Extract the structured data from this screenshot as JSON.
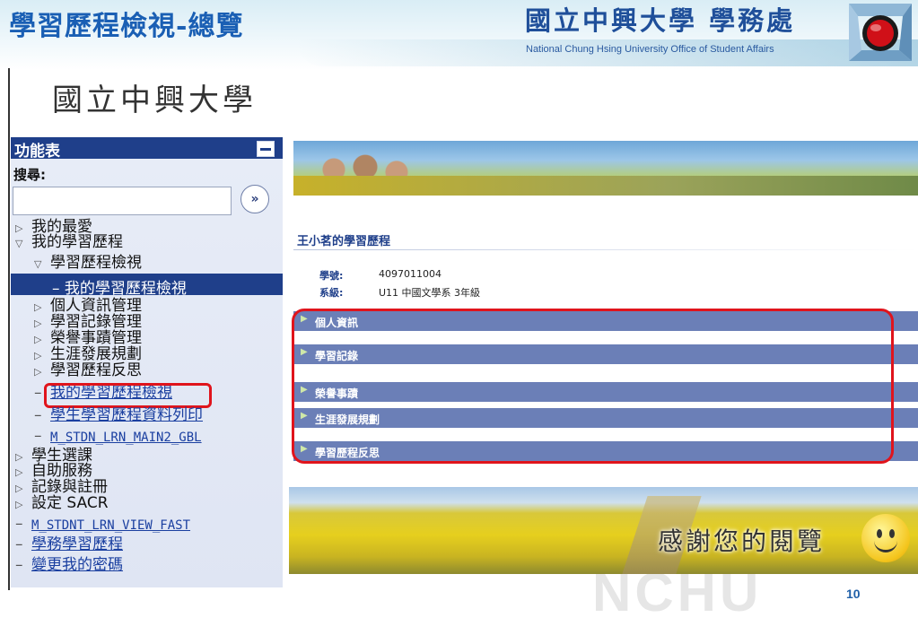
{
  "slide": {
    "title": "學習歷程檢視-總覽",
    "office_name_zh": "國立中興大學 學務處",
    "office_name_en": "National Chung Hsing University Office of Student Affairs",
    "page_number": "10",
    "watermark": "NCHU",
    "thanks_text": "感謝您的閱覽"
  },
  "university_name": "國立中興大學",
  "menu": {
    "header": "功能表",
    "search_label": "搜尋:",
    "search_value": "",
    "go_symbol": "»",
    "items": [
      {
        "label": "我的最愛",
        "type": "collapsed"
      },
      {
        "label": "我的學習歷程",
        "type": "expanded"
      },
      {
        "label": "學習歷程檢視",
        "type": "expanded"
      },
      {
        "label": "– 我的學習歷程檢視",
        "type": "selected"
      },
      {
        "label": "個人資訊管理",
        "type": "collapsed"
      },
      {
        "label": "學習記錄管理",
        "type": "collapsed"
      },
      {
        "label": "榮譽事蹟管理",
        "type": "collapsed"
      },
      {
        "label": "生涯發展規劃",
        "type": "collapsed"
      },
      {
        "label": "學習歷程反思",
        "type": "collapsed"
      },
      {
        "label": "我的學習歷程檢視",
        "type": "link"
      },
      {
        "label": "學生學習歷程資料列印",
        "type": "link"
      },
      {
        "label": "M_STDN_LRN_MAIN2_GBL",
        "type": "link"
      },
      {
        "label": "學生選課",
        "type": "collapsed"
      },
      {
        "label": "自助服務",
        "type": "collapsed"
      },
      {
        "label": "記錄與註冊",
        "type": "collapsed"
      },
      {
        "label": "設定 SACR",
        "type": "collapsed"
      },
      {
        "label": "M_STDNT_LRN_VIEW_FAST",
        "type": "link"
      },
      {
        "label": "學務學習歷程",
        "type": "link"
      },
      {
        "label": "變更我的密碼",
        "type": "link"
      }
    ]
  },
  "main": {
    "student_title": "王小茗的學習歷程",
    "student_id_label": "學號:",
    "student_id": "4097011004",
    "dept_label": "系級:",
    "dept": "U11 中國文學系 3年級",
    "sections": [
      "個人資訊",
      "學習記錄",
      "榮譽事蹟",
      "生涯發展規劃",
      "學習歷程反思"
    ]
  },
  "colors": {
    "menu_header": "#1f3f8a",
    "section_bar": "#6b7fb7",
    "highlight": "#e0141c",
    "title_blue": "#1a5fb4"
  }
}
